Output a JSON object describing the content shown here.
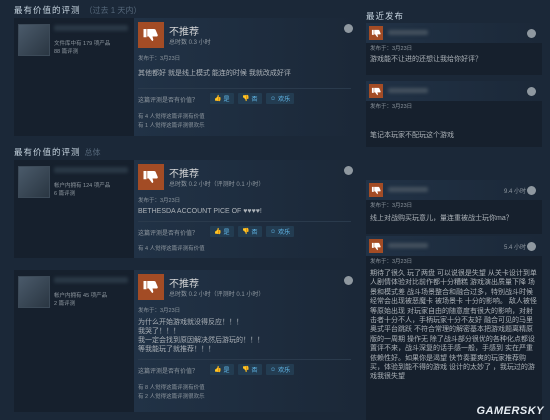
{
  "left": {
    "section1": {
      "title": "最有价值的评测",
      "subtitle": "（过去 1 天内）"
    },
    "section2": {
      "title": "最有价值的评测",
      "subtitle": "总体"
    },
    "reviews": [
      {
        "author_line1": "文件库中有 179 项产品",
        "author_line2": "88 篇评测",
        "verdict": "不推荐",
        "hours": "总时数 0.3 小时",
        "posted": "发布于：3月23日",
        "text": "其他都好 就是线上模式 能连的时候 我就改成好评",
        "helpful_q": "这篇评测是否有价值？",
        "yes": "是",
        "no": "否",
        "funny": "欢乐",
        "stat1": "有 4 人觉得这篇评测有价值",
        "stat2": "有 1 人觉得这篇评测很欢乐"
      },
      {
        "author_line1": "帐户内拥有 124 项产品",
        "author_line2": "6 篇评测",
        "verdict": "不推荐",
        "hours": "总时数 0.2 小时（评测时 0.1 小时）",
        "posted": "发布于：3月23日",
        "text": "BETHESDA ACCOUNT PICE OF ♥♥♥♥!",
        "helpful_q": "这篇评测是否有价值？",
        "yes": "是",
        "no": "否",
        "funny": "欢乐",
        "stat1": "有 4 人觉得这篇评测有价值",
        "stat2": ""
      },
      {
        "author_line1": "帐户内拥有 45 项产品",
        "author_line2": "2 篇评测",
        "verdict": "不推荐",
        "hours": "总时数 0.2 小时（评测时 0.1 小时）",
        "posted": "发布于：3月23日",
        "text": "为什么开始游戏就没得反应！！！\n我哭了！！！\n我一定会找到原因解决然后游玩的！！！\n等我能玩了就推荐！！！",
        "helpful_q": "这篇评测是否有价值？",
        "yes": "是",
        "no": "否",
        "funny": "欢乐",
        "stat1": "有 8 人觉得这篇评测有价值",
        "stat2": "有 2 人觉得这篇评测很欢乐"
      }
    ]
  },
  "right": {
    "title": "最近发布",
    "reviews": [
      {
        "hours": "",
        "posted": "发布于：3月23日",
        "text": "游戏能不让进的还想让我给你好评？"
      },
      {
        "hours": "",
        "posted": "发布于：3月23日",
        "text": "笔记本玩家不配玩这个游戏"
      },
      {
        "hours": "9.4 小时",
        "posted": "发布于：3月23日",
        "text": "线上对战购买玩意儿，量连重被战士玩你ma？"
      },
      {
        "hours": "5.4 小时",
        "posted": "发布于：3月23日",
        "text": "期待了很久 玩了两盘 可以说很是失望 从关卡设计到单人剧情体验对比前作都十分糟糕 游戏演出质量下降 场景和模式差 战斗场景整合和融合过多，特别战斗时候经常会出现被恶魔卡 被场景卡 十分的影响。 敌人被怪等原始出现 对玩家自由的随意度有很大的影响，对射击者十分不人，手柄玩家十分不友好 融合可见的马里奥式平台跳跃 不符合常理的解密基本把游戏题离精原版的一周期 操作无 除了战斗部分很优的各种化点都设置评不来，战斗深复的话手感一般，手感到 实在严重依赖性好。如果你是渴望 快节奏要爽的玩家推荐购买，体验到能不得的游戏 设计的太妙了 ，我玩过的游戏我很失望"
      }
    ]
  },
  "watermark": "GAMERSKY",
  "colors": {
    "thumb_down": "#a34c25",
    "bg": "#1b2838",
    "link": "#66c0f4"
  }
}
